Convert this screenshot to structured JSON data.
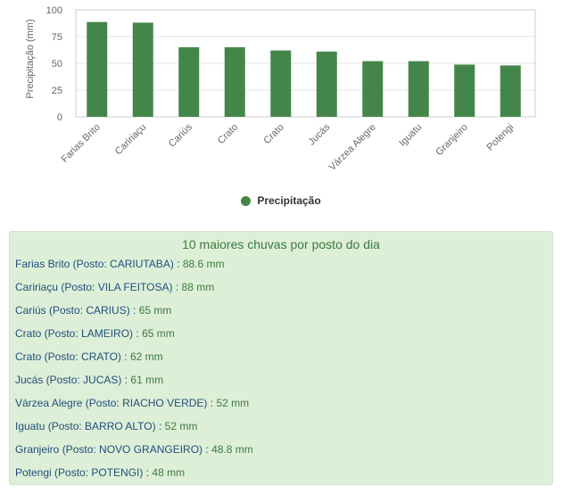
{
  "chart_data": {
    "type": "bar",
    "categories": [
      "Farias Brito",
      "Caririaçu",
      "Cariús",
      "Crato",
      "Crato",
      "Jucás",
      "Várzea Alegre",
      "Iguatu",
      "Granjeiro",
      "Potengi"
    ],
    "series": [
      {
        "name": "Precipitação",
        "values": [
          88.6,
          88,
          65,
          65,
          62,
          61,
          52,
          52,
          48.8,
          48
        ]
      }
    ],
    "ylabel": "Precipitação (mm)",
    "xlabel": "",
    "ylim": [
      0,
      100
    ],
    "yticks": [
      "0",
      "25",
      "50",
      "75",
      "100"
    ],
    "bar_color": "#44864a",
    "grid": true,
    "legend": "bottom-center"
  },
  "panel": {
    "title": "10 maiores chuvas por posto do dia",
    "items": [
      {
        "location": "Farias Brito (Posto: CARIUTABA)",
        "sep": " : ",
        "value": "88.6 mm"
      },
      {
        "location": "Caririaçu (Posto: VILA FEITOSA)",
        "sep": " : ",
        "value": "88 mm"
      },
      {
        "location": "Cariús (Posto: CARIUS)",
        "sep": " : ",
        "value": "65 mm"
      },
      {
        "location": "Crato (Posto: LAMEIRO)",
        "sep": " : ",
        "value": "65 mm"
      },
      {
        "location": "Crato (Posto: CRATO)",
        "sep": " : ",
        "value": "62 mm"
      },
      {
        "location": "Jucás (Posto: JUCAS)",
        "sep": " : ",
        "value": "61 mm"
      },
      {
        "location": "Várzea Alegre (Posto: RIACHO VERDE)",
        "sep": " : ",
        "value": "52 mm"
      },
      {
        "location": "Iguatu (Posto: BARRO ALTO)",
        "sep": " : ",
        "value": "52 mm"
      },
      {
        "location": "Granjeiro (Posto: NOVO GRANGEIRO)",
        "sep": " : ",
        "value": "48.8 mm"
      },
      {
        "location": "Potengi (Posto: POTENGI)",
        "sep": " : ",
        "value": "48 mm"
      }
    ]
  }
}
